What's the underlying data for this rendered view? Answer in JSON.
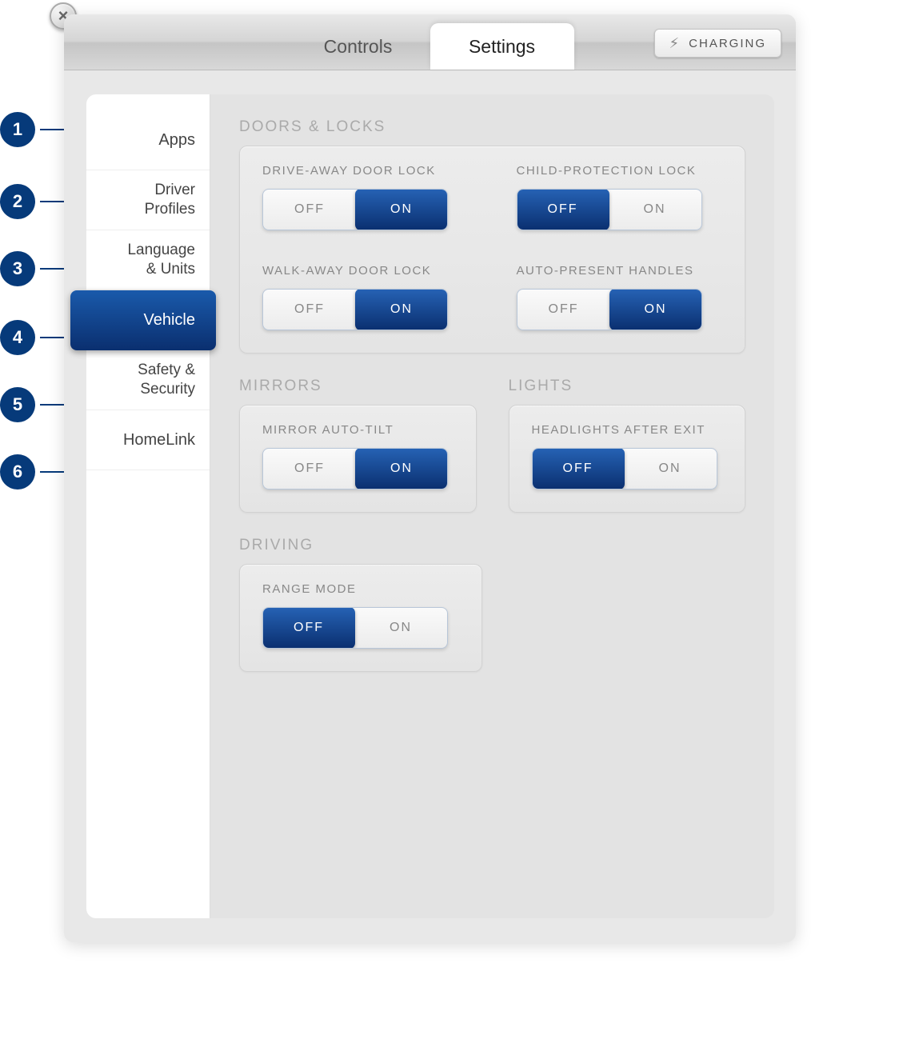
{
  "close_label": "×",
  "tabs": {
    "controls": "Controls",
    "settings": "Settings"
  },
  "charging_label": "CHARGING",
  "toggle_labels": {
    "off": "OFF",
    "on": "ON"
  },
  "sidebar": {
    "items": [
      {
        "label": "Apps"
      },
      {
        "label": "Driver\nProfiles"
      },
      {
        "label": "Language\n& Units"
      },
      {
        "label": "Vehicle",
        "active": true
      },
      {
        "label": "Safety &\nSecurity"
      },
      {
        "label": "HomeLink"
      }
    ]
  },
  "markers": [
    "1",
    "2",
    "3",
    "4",
    "5",
    "6"
  ],
  "sections": {
    "doors_locks": {
      "title": "DOORS & LOCKS",
      "settings": [
        {
          "label": "DRIVE-AWAY DOOR LOCK",
          "value": "ON"
        },
        {
          "label": "CHILD-PROTECTION LOCK",
          "value": "OFF"
        },
        {
          "label": "WALK-AWAY DOOR LOCK",
          "value": "ON"
        },
        {
          "label": "AUTO-PRESENT HANDLES",
          "value": "ON"
        }
      ]
    },
    "mirrors": {
      "title": "MIRRORS",
      "settings": [
        {
          "label": "MIRROR AUTO-TILT",
          "value": "ON"
        }
      ]
    },
    "lights": {
      "title": "LIGHTS",
      "settings": [
        {
          "label": "HEADLIGHTS AFTER EXIT",
          "value": "OFF"
        }
      ]
    },
    "driving": {
      "title": "DRIVING",
      "settings": [
        {
          "label": "RANGE MODE",
          "value": "OFF"
        }
      ]
    }
  }
}
